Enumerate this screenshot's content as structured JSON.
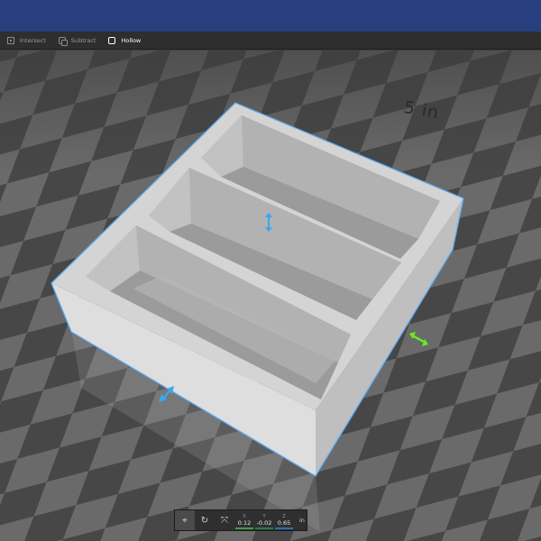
{
  "toolbar": {
    "tools": [
      {
        "label": "Intersect",
        "icon": "intersect-icon",
        "active": false
      },
      {
        "label": "Subtract",
        "icon": "subtract-icon",
        "active": false
      },
      {
        "label": "Hollow",
        "icon": "hollow-icon",
        "active": true
      }
    ]
  },
  "viewport": {
    "scale_label": "5 in",
    "colors": {
      "selection_outline": "#5aaaf0",
      "move_handle": "#3aa7f0",
      "rotate_handle": "#66ee22"
    }
  },
  "transform_bar": {
    "icons": [
      "snap-icon",
      "rotate-icon",
      "scale-icon"
    ],
    "coords": [
      {
        "axis": "X",
        "value": "0.12",
        "color": "#3ea04a"
      },
      {
        "axis": "Y",
        "value": "-0.02",
        "color": "#2c7d44"
      },
      {
        "axis": "Z",
        "value": "0.65",
        "color": "#2f6fb8"
      }
    ],
    "unit": "in"
  }
}
